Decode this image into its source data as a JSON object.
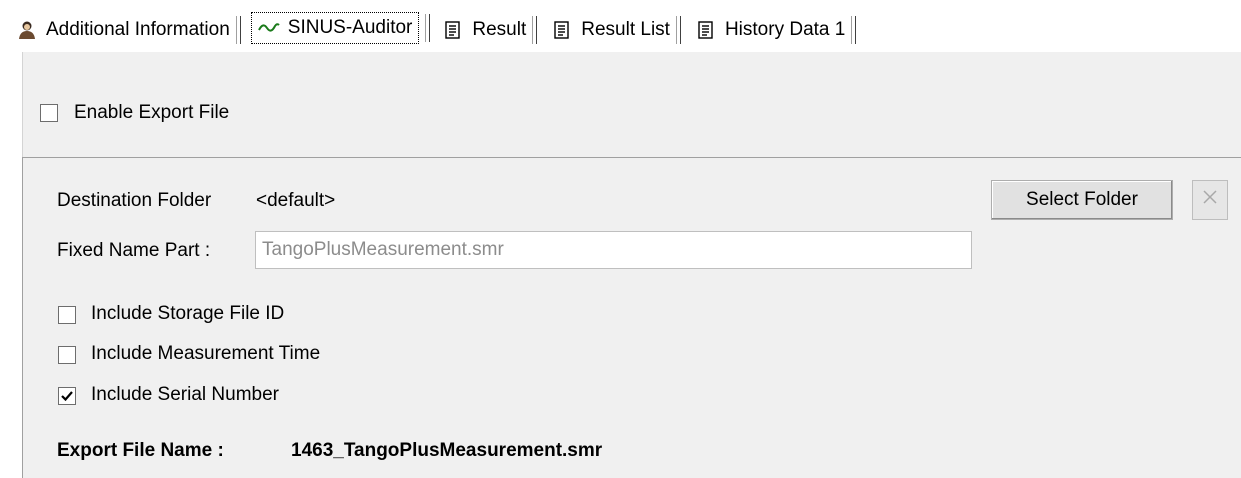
{
  "tabs": [
    {
      "label": "Additional Information",
      "icon": "person-icon",
      "active": false
    },
    {
      "label": "SINUS-Auditor",
      "icon": "sine-wave-icon",
      "active": true
    },
    {
      "label": "Result",
      "icon": "document-icon",
      "active": false
    },
    {
      "label": "Result List",
      "icon": "document-icon",
      "active": false
    },
    {
      "label": "History Data 1",
      "icon": "document-icon",
      "active": false
    }
  ],
  "enable_export": {
    "label": "Enable Export File",
    "checked": false
  },
  "destination": {
    "label": "Destination Folder",
    "value": "<default>"
  },
  "select_folder_label": "Select Folder",
  "clear_icon": "close-icon",
  "fixed_name": {
    "label": "Fixed Name Part :",
    "value": "TangoPlusMeasurement.smr"
  },
  "options": [
    {
      "label": "Include Storage File ID",
      "checked": false
    },
    {
      "label": "Include Measurement Time",
      "checked": false
    },
    {
      "label": "Include Serial Number",
      "checked": true
    }
  ],
  "export_file": {
    "label": "Export File Name :",
    "value": "1463_TangoPlusMeasurement.smr"
  },
  "colors": {
    "panel": "#f0f0f0",
    "wave": "#1a7a1a",
    "disabled_text": "#8c8c8c"
  }
}
